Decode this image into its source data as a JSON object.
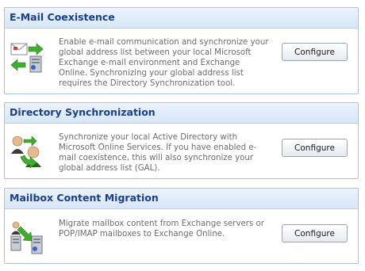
{
  "sections": [
    {
      "title": "E-Mail Coexistence",
      "description": "Enable e-mail communication and synchronize your global address list between your local Microsoft Exchange e-mail environment and Exchange Online. Synchronizing your global address list requires the Directory Synchronization tool.",
      "button_label": "Configure",
      "icon": "email-server-sync-icon"
    },
    {
      "title": "Directory Synchronization",
      "description": "Synchronize your local Active Directory with Microsoft Online Services. If you have enabled e-mail coexistence, this will also synchronize your global address list (GAL).",
      "button_label": "Configure",
      "icon": "user-directory-sync-icon"
    },
    {
      "title": "Mailbox Content Migration",
      "description": "Migrate mailbox content from Exchange servers or POP/IMAP mailboxes to Exchange Online.",
      "button_label": "Configure",
      "icon": "mailbox-server-migration-icon"
    }
  ],
  "colors": {
    "header_text": "#1d3d8f",
    "panel_border": "#a9c4e6",
    "header_bg": "#dce9f8",
    "arrow_green": "#3fae2a"
  }
}
